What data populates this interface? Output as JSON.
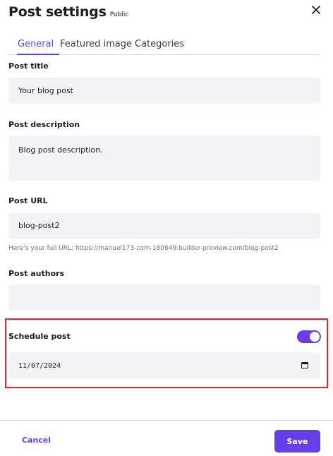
{
  "header": {
    "title": "Post settings",
    "badge": "Public",
    "close_icon": "close-icon"
  },
  "tabs": [
    {
      "label": "General",
      "active": true
    },
    {
      "label": "Featured image",
      "active": false
    },
    {
      "label": "Categories",
      "active": false
    }
  ],
  "form": {
    "post_title": {
      "label": "Post title",
      "value": "Your blog post"
    },
    "post_description": {
      "label": "Post description",
      "value": "Blog post description."
    },
    "post_url": {
      "label": "Post URL",
      "value": "blog-post2",
      "hint": "Here's your full URL: https://manuel173-com-180649.builder-preview.com/blog-post2"
    },
    "post_authors": {
      "label": "Post authors",
      "value": ""
    },
    "schedule": {
      "label": "Schedule post",
      "enabled": true,
      "date": "11/07/2024",
      "calendar_icon": "calendar-icon"
    }
  },
  "footer": {
    "cancel_label": "Cancel",
    "save_label": "Save"
  },
  "colors": {
    "accent": "#673de6",
    "field_bg": "#f2f3f6",
    "highlight_border": "#d62a2a"
  }
}
